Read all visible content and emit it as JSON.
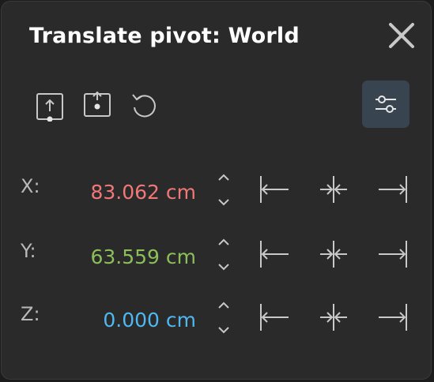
{
  "panel": {
    "title": "Translate pivot: World"
  },
  "toolbar": {
    "icons": [
      "pivot-to-bottom-icon",
      "pivot-to-center-icon",
      "reset-icon"
    ],
    "settings_icon": "sliders-icon",
    "settings_active_color": "#384550"
  },
  "axes": [
    {
      "label": "X:",
      "value": "83.062 cm",
      "color": "#f07878"
    },
    {
      "label": "Y:",
      "value": "63.559 cm",
      "color": "#8cbf5a"
    },
    {
      "label": "Z:",
      "value": "0.000 cm",
      "color": "#4fb8f0"
    }
  ],
  "align_icons": [
    "align-left-icon",
    "align-center-icon",
    "align-right-icon"
  ],
  "colors": {
    "background": "#2a2a2a",
    "text": "#ffffff",
    "icon": "#c8c8c8",
    "label": "#b9b9b9"
  }
}
